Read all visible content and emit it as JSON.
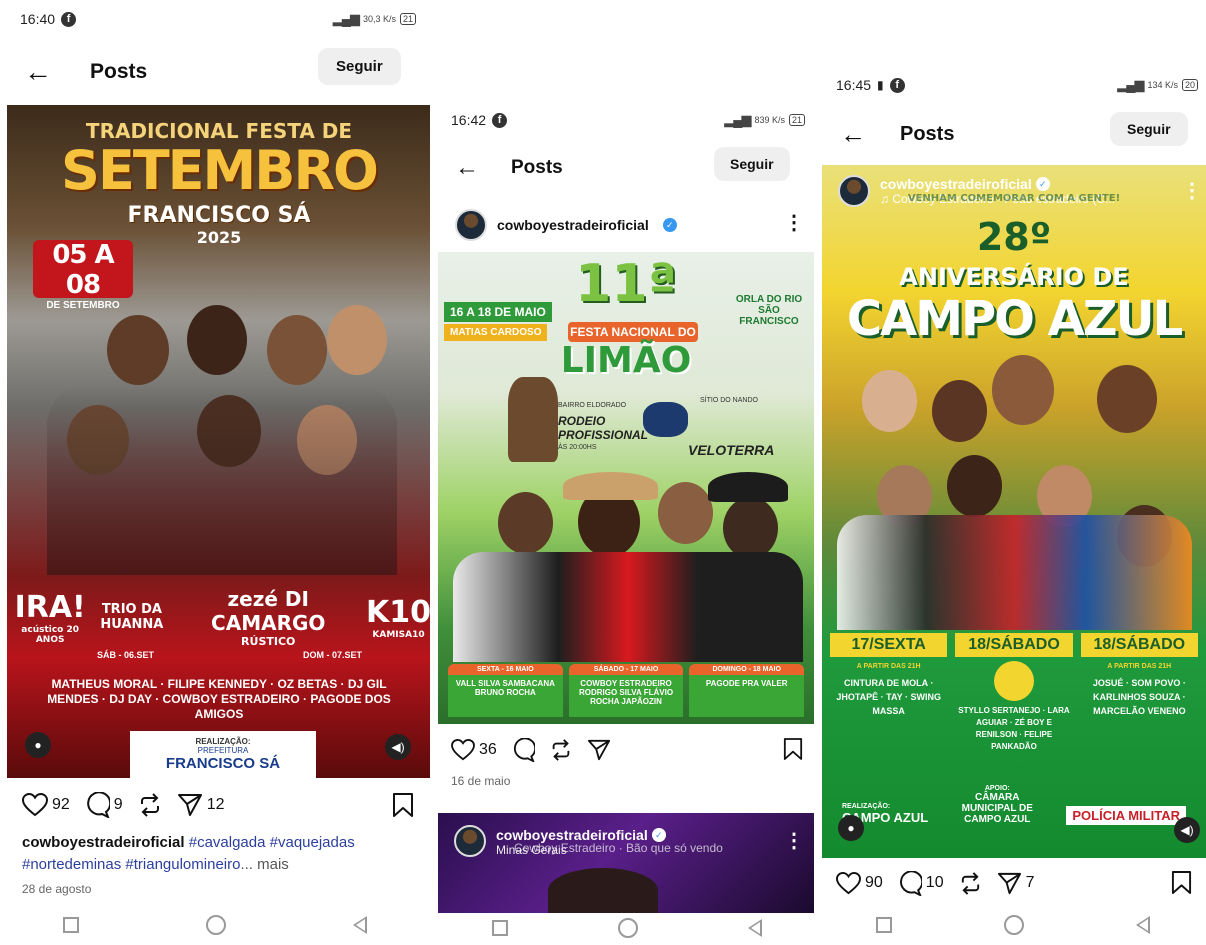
{
  "phone1": {
    "status": {
      "time": "16:40",
      "speed": "30,3 K/s",
      "battery": "21"
    },
    "title": "Posts",
    "follow": "Seguir",
    "poster": {
      "line1": "TRADICIONAL FESTA DE",
      "line2": "SETEMBRO",
      "line3": "FRANCISCO SÁ",
      "line4": "2025",
      "dates": "05 A 08",
      "dates_sub": "DE SETEMBRO",
      "act1": "IRA!",
      "act1_sub": "acústico 20 ANOS",
      "act2": "TRIO DA HUANNA",
      "act3": "zezé DI CAMARGO",
      "act3_sub": "RÚSTICO",
      "act4": "K10",
      "act4_sub": "KAMISA10",
      "day1": "SÁB - 06.SET",
      "day2": "DOM - 07.SET",
      "names": "MATHEUS MORAL · FILIPE KENNEDY · OZ BETAS · DJ GIL MENDES · DJ DAY · COWBOY ESTRADEIRO · PAGODE DOS AMIGOS",
      "realizacao": "REALIZAÇÃO:",
      "prefeitura": "PREFEITURA",
      "city": "FRANCISCO SÁ"
    },
    "likes": "92",
    "comments": "9",
    "shares": "12",
    "caption_user": "cowboyestradeiroficial",
    "caption_tags": "#cavalgada #vaquejadas #nortedeminas #triangulomineiro",
    "caption_more": "... mais",
    "date": "28 de agosto"
  },
  "phone2": {
    "status": {
      "time": "16:42",
      "speed": "839 K/s",
      "battery": "21"
    },
    "title": "Posts",
    "follow": "Seguir",
    "username": "cowboyestradeiroficial",
    "poster": {
      "dates": "16 A 18 DE MAIO",
      "place": "MATIAS CARDOSO",
      "number": "11ª",
      "festa": "FESTA NACIONAL DO",
      "limao": "LIMÃO",
      "orla": "ORLA DO RIO SÃO FRANCISCO",
      "bairro": "BAIRRO ELDORADO",
      "rodeio": "RODEIO PROFISSIONAL",
      "rodeio_time": "ÀS 20:00HS",
      "sitio": "SÍTIO DO NANDO",
      "veloterra": "VELOTERRA",
      "col1_head": "SEXTA - 16 MAIO",
      "col1_body": "VALL SILVA SAMBACANA BRUNO ROCHA",
      "col2_head": "SÁBADO - 17 MAIO",
      "col2_body": "COWBOY ESTRADEIRO RODRIGO SILVA FLÁVIO ROCHA JAPÃOZIN",
      "col3_head": "DOMINGO - 18 MAIO",
      "col3_body": "PAGODE PRA VALER"
    },
    "likes": "36",
    "date": "16 de maio",
    "next_username": "cowboyestradeiroficial",
    "next_sub1": "Minas Gerais",
    "next_sub2": "Cowboy Estradeiro · Bão que só vendo"
  },
  "phone3": {
    "status": {
      "time": "16:45",
      "speed": "134 K/s",
      "battery": "20"
    },
    "title": "Posts",
    "follow": "Seguir",
    "username": "cowboyestradeiroficial",
    "music": "Cowboy Estradeiro · Peão estradeiro (C...",
    "poster": {
      "top": "VENHAM COMEMORAR COM A GENTE!",
      "number": "28º",
      "aniv": "ANIVERSÁRIO DE",
      "city": "CAMPO AZUL",
      "d1": "17/SEXTA",
      "d2": "18/SÁBADO",
      "d3": "18/SÁBADO",
      "from1": "A PARTIR DAS 21H",
      "from3": "A PARTIR DAS 21H",
      "c1": "CINTURA DE MOLA · JHOTAPÊ · TAY · SWING MASSA",
      "c2": "STYLLO SERTANEJO · LARA AGUIAR · ZÉ BOY E RENILSON · FELIPE PANKADÃO",
      "c3": "JOSUÉ · SOM POVO · KARLINHOS SOUZA · MARCELÃO VENENO",
      "real": "REALIZAÇÃO:",
      "pref": "CAMPO AZUL",
      "apoio": "APOIO:",
      "camara": "CÂMARA MUNICIPAL DE CAMPO AZUL",
      "policia": "POLÍCIA MILITAR"
    },
    "likes": "90",
    "comments": "10",
    "shares": "7"
  },
  "colors": {
    "accent_blue": "#3897f0",
    "hashtag": "#2c3f9e",
    "poster1_red": "#b8141b",
    "poster2_green": "#3aa635",
    "poster3_green": "#1f9a3c"
  }
}
